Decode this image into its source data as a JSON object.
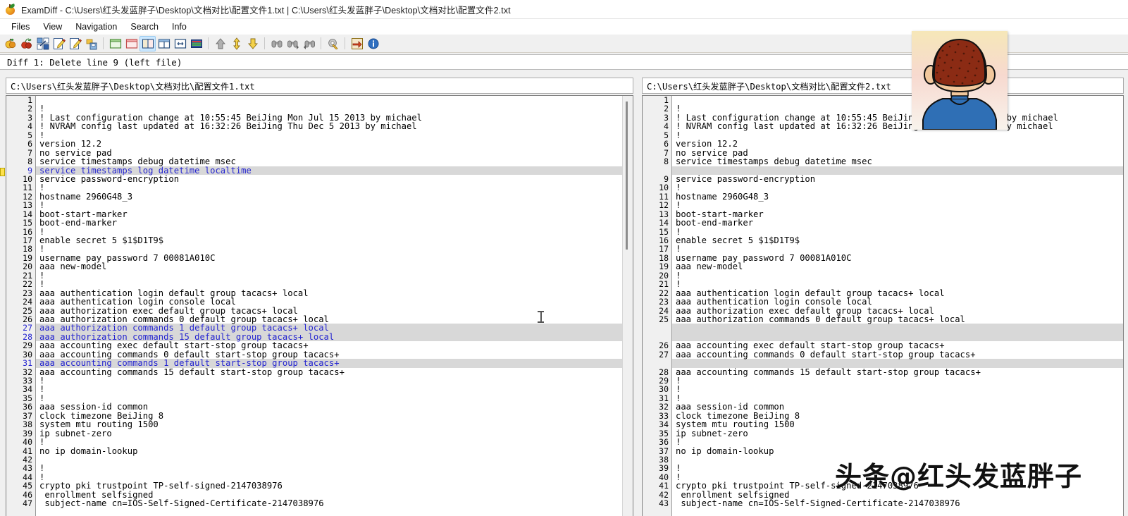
{
  "window": {
    "app_name": "ExamDiff",
    "title": "ExamDiff - C:\\Users\\红头发蓝胖子\\Desktop\\文档对比\\配置文件1.txt  |  C:\\Users\\红头发蓝胖子\\Desktop\\文档对比\\配置文件2.txt",
    "icon": "apple-icon"
  },
  "menubar": {
    "items": [
      {
        "label": "Files"
      },
      {
        "label": "View"
      },
      {
        "label": "Navigation"
      },
      {
        "label": "Search"
      },
      {
        "label": "Info"
      }
    ]
  },
  "toolbar": {
    "buttons": [
      {
        "name": "compare-files-icon",
        "title": "Compare Files"
      },
      {
        "name": "compare-directories-icon",
        "title": "Compare Directories"
      },
      {
        "name": "recompare-icon",
        "title": "Recompare"
      },
      {
        "name": "edit-left-file-icon",
        "title": "Edit Left File"
      },
      {
        "name": "edit-right-file-icon",
        "title": "Edit Right File"
      },
      {
        "name": "save-icon",
        "title": "Save"
      },
      {
        "name": "view-left-only-icon",
        "title": "Left Pane Only"
      },
      {
        "name": "view-right-only-icon",
        "title": "Right Pane Only"
      },
      {
        "name": "view-side-by-side-icon",
        "title": "Side by Side View"
      },
      {
        "name": "view-horizontal-split-icon",
        "title": "Horizontal Split"
      },
      {
        "name": "view-inline-icon",
        "title": "Inline View"
      },
      {
        "name": "view-unified-icon",
        "title": "Unified View"
      },
      {
        "name": "previous-diff-icon",
        "title": "Previous Difference"
      },
      {
        "name": "next-change-icon",
        "title": "Next Change"
      },
      {
        "name": "next-diff-icon",
        "title": "Next Difference"
      },
      {
        "name": "find-icon",
        "title": "Find"
      },
      {
        "name": "find-next-icon",
        "title": "Find Next"
      },
      {
        "name": "find-previous-icon",
        "title": "Find Previous"
      },
      {
        "name": "options-icon",
        "title": "Options"
      },
      {
        "name": "export-icon",
        "title": "Export Report"
      },
      {
        "name": "about-icon",
        "title": "About"
      }
    ],
    "active_index": 8
  },
  "status": {
    "diff_text": "Diff 1: Delete line 9 (left file)"
  },
  "colors": {
    "diff_text": "#2525d0",
    "diff_background": "#d8d8d8",
    "marker_yellow": "#ffe14d",
    "toolbar_active": "#cce8ff"
  },
  "left_pane": {
    "path": "C:\\Users\\红头发蓝胖子\\Desktop\\文档对比\\配置文件1.txt",
    "marker_line": 9,
    "lines": [
      {
        "n": "1",
        "t": "",
        "d": false
      },
      {
        "n": "2",
        "t": "!",
        "d": false
      },
      {
        "n": "3",
        "t": "! Last configuration change at 10:55:45 BeiJing Mon Jul 15 2013 by michael",
        "d": false
      },
      {
        "n": "4",
        "t": "! NVRAM config last updated at 16:32:26 BeiJing Thu Dec 5 2013 by michael",
        "d": false
      },
      {
        "n": "5",
        "t": "!",
        "d": false
      },
      {
        "n": "6",
        "t": "version 12.2",
        "d": false
      },
      {
        "n": "7",
        "t": "no service pad",
        "d": false
      },
      {
        "n": "8",
        "t": "service timestamps debug datetime msec",
        "d": false
      },
      {
        "n": "9",
        "t": "service timestamps log datetime localtime",
        "d": true
      },
      {
        "n": "10",
        "t": "service password-encryption",
        "d": false
      },
      {
        "n": "11",
        "t": "!",
        "d": false
      },
      {
        "n": "12",
        "t": "hostname 2960G48_3",
        "d": false
      },
      {
        "n": "13",
        "t": "!",
        "d": false
      },
      {
        "n": "14",
        "t": "boot-start-marker",
        "d": false
      },
      {
        "n": "15",
        "t": "boot-end-marker",
        "d": false
      },
      {
        "n": "16",
        "t": "!",
        "d": false
      },
      {
        "n": "17",
        "t": "enable secret 5 $1$D1T9$",
        "d": false
      },
      {
        "n": "18",
        "t": "!",
        "d": false
      },
      {
        "n": "19",
        "t": "username pay password 7 00081A010C",
        "d": false
      },
      {
        "n": "20",
        "t": "aaa new-model",
        "d": false
      },
      {
        "n": "21",
        "t": "!",
        "d": false
      },
      {
        "n": "22",
        "t": "!",
        "d": false
      },
      {
        "n": "23",
        "t": "aaa authentication login default group tacacs+ local",
        "d": false
      },
      {
        "n": "24",
        "t": "aaa authentication login console local",
        "d": false
      },
      {
        "n": "25",
        "t": "aaa authorization exec default group tacacs+ local",
        "d": false
      },
      {
        "n": "26",
        "t": "aaa authorization commands 0 default group tacacs+ local",
        "d": false
      },
      {
        "n": "27",
        "t": "aaa authorization commands 1 default group tacacs+ local",
        "d": true
      },
      {
        "n": "28",
        "t": "aaa authorization commands 15 default group tacacs+ local",
        "d": true
      },
      {
        "n": "29",
        "t": "aaa accounting exec default start-stop group tacacs+",
        "d": false
      },
      {
        "n": "30",
        "t": "aaa accounting commands 0 default start-stop group tacacs+",
        "d": false
      },
      {
        "n": "31",
        "t": "aaa accounting commands 1 default start-stop group tacacs+",
        "d": true
      },
      {
        "n": "32",
        "t": "aaa accounting commands 15 default start-stop group tacacs+",
        "d": false
      },
      {
        "n": "33",
        "t": "!",
        "d": false
      },
      {
        "n": "34",
        "t": "!",
        "d": false
      },
      {
        "n": "35",
        "t": "!",
        "d": false
      },
      {
        "n": "36",
        "t": "aaa session-id common",
        "d": false
      },
      {
        "n": "37",
        "t": "clock timezone BeiJing 8",
        "d": false
      },
      {
        "n": "38",
        "t": "system mtu routing 1500",
        "d": false
      },
      {
        "n": "39",
        "t": "ip subnet-zero",
        "d": false
      },
      {
        "n": "40",
        "t": "!",
        "d": false
      },
      {
        "n": "41",
        "t": "no ip domain-lookup",
        "d": false
      },
      {
        "n": "42",
        "t": "",
        "d": false
      },
      {
        "n": "43",
        "t": "!",
        "d": false
      },
      {
        "n": "44",
        "t": "!",
        "d": false
      },
      {
        "n": "45",
        "t": "crypto pki trustpoint TP-self-signed-2147038976",
        "d": false
      },
      {
        "n": "46",
        "t": " enrollment selfsigned",
        "d": false
      },
      {
        "n": "47",
        "t": " subject-name cn=IOS-Self-Signed-Certificate-2147038976",
        "d": false
      }
    ]
  },
  "right_pane": {
    "path": "C:\\Users\\红头发蓝胖子\\Desktop\\文档对比\\配置文件2.txt",
    "lines": [
      {
        "n": "1",
        "t": "",
        "g": false
      },
      {
        "n": "2",
        "t": "!",
        "g": false
      },
      {
        "n": "3",
        "t": "! Last configuration change at 10:55:45 BeiJing Mon Jul 15 2013 by michael",
        "g": false
      },
      {
        "n": "4",
        "t": "! NVRAM config last updated at 16:32:26 BeiJing Thu Dec 5 2013 by michael",
        "g": false
      },
      {
        "n": "5",
        "t": "!",
        "g": false
      },
      {
        "n": "6",
        "t": "version 12.2",
        "g": false
      },
      {
        "n": "7",
        "t": "no service pad",
        "g": false
      },
      {
        "n": "8",
        "t": "service timestamps debug datetime msec",
        "g": false
      },
      {
        "n": "",
        "t": "",
        "g": true
      },
      {
        "n": "9",
        "t": "service password-encryption",
        "g": false
      },
      {
        "n": "10",
        "t": "!",
        "g": false
      },
      {
        "n": "11",
        "t": "hostname 2960G48_3",
        "g": false
      },
      {
        "n": "12",
        "t": "!",
        "g": false
      },
      {
        "n": "13",
        "t": "boot-start-marker",
        "g": false
      },
      {
        "n": "14",
        "t": "boot-end-marker",
        "g": false
      },
      {
        "n": "15",
        "t": "!",
        "g": false
      },
      {
        "n": "16",
        "t": "enable secret 5 $1$D1T9$",
        "g": false
      },
      {
        "n": "17",
        "t": "!",
        "g": false
      },
      {
        "n": "18",
        "t": "username pay password 7 00081A010C",
        "g": false
      },
      {
        "n": "19",
        "t": "aaa new-model",
        "g": false
      },
      {
        "n": "20",
        "t": "!",
        "g": false
      },
      {
        "n": "21",
        "t": "!",
        "g": false
      },
      {
        "n": "22",
        "t": "aaa authentication login default group tacacs+ local",
        "g": false
      },
      {
        "n": "23",
        "t": "aaa authentication login console local",
        "g": false
      },
      {
        "n": "24",
        "t": "aaa authorization exec default group tacacs+ local",
        "g": false
      },
      {
        "n": "25",
        "t": "aaa authorization commands 0 default group tacacs+ local",
        "g": false
      },
      {
        "n": "",
        "t": "",
        "g": true
      },
      {
        "n": "",
        "t": "",
        "g": true
      },
      {
        "n": "26",
        "t": "aaa accounting exec default start-stop group tacacs+",
        "g": false
      },
      {
        "n": "27",
        "t": "aaa accounting commands 0 default start-stop group tacacs+",
        "g": false
      },
      {
        "n": "",
        "t": "",
        "g": true
      },
      {
        "n": "28",
        "t": "aaa accounting commands 15 default start-stop group tacacs+",
        "g": false
      },
      {
        "n": "29",
        "t": "!",
        "g": false
      },
      {
        "n": "30",
        "t": "!",
        "g": false
      },
      {
        "n": "31",
        "t": "!",
        "g": false
      },
      {
        "n": "32",
        "t": "aaa session-id common",
        "g": false
      },
      {
        "n": "33",
        "t": "clock timezone BeiJing 8",
        "g": false
      },
      {
        "n": "34",
        "t": "system mtu routing 1500",
        "g": false
      },
      {
        "n": "35",
        "t": "ip subnet-zero",
        "g": false
      },
      {
        "n": "36",
        "t": "!",
        "g": false
      },
      {
        "n": "37",
        "t": "no ip domain-lookup",
        "g": false
      },
      {
        "n": "38",
        "t": "",
        "g": false
      },
      {
        "n": "39",
        "t": "!",
        "g": false
      },
      {
        "n": "40",
        "t": "!",
        "g": false
      },
      {
        "n": "41",
        "t": "crypto pki trustpoint TP-self-signed-2147038976",
        "g": false
      },
      {
        "n": "42",
        "t": " enrollment selfsigned",
        "g": false
      },
      {
        "n": "43",
        "t": " subject-name cn=IOS-Self-Signed-Certificate-2147038976",
        "g": false
      }
    ]
  },
  "overlay": {
    "avatar_name": "user-avatar-cartoon-back-of-head",
    "watermark_text": "头条@红头发蓝胖子"
  }
}
